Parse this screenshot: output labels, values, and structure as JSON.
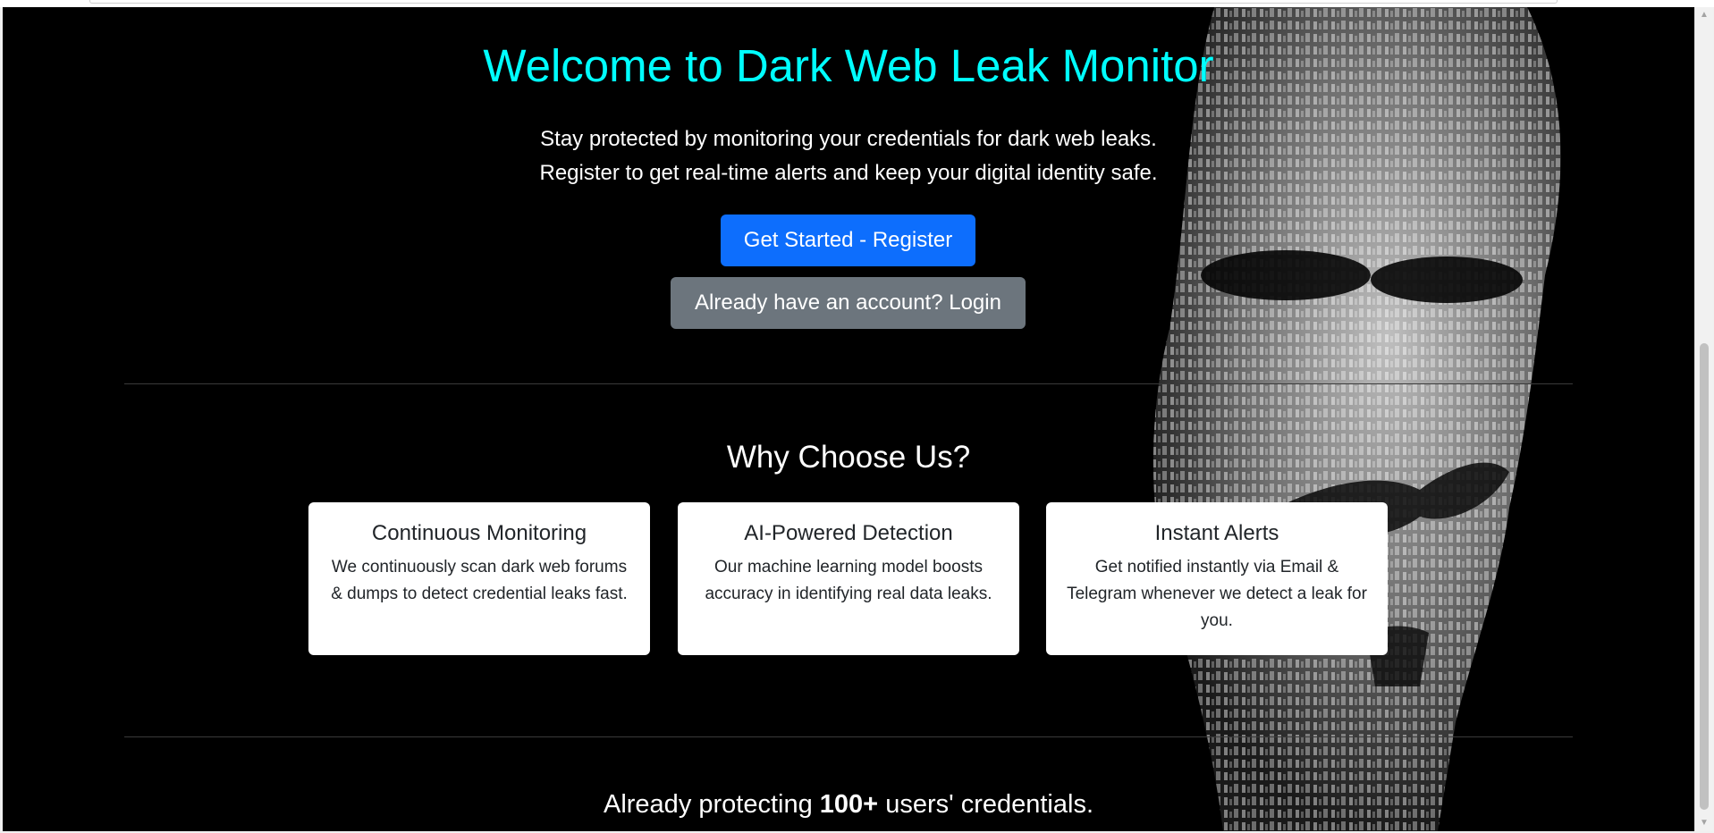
{
  "hero": {
    "title": "Welcome to Dark Web Leak Monitor",
    "line1": "Stay protected by monitoring your credentials for dark web leaks.",
    "line2": "Register to get real-time alerts and keep your digital identity safe.",
    "register_button": "Get Started - Register",
    "login_button": "Already have an account? Login"
  },
  "features": {
    "heading": "Why Choose Us?",
    "cards": [
      {
        "title": "Continuous Monitoring",
        "text": "We continuously scan dark web forums & dumps to detect credential leaks fast."
      },
      {
        "title": "AI-Powered Detection",
        "text": "Our machine learning model boosts accuracy in identifying real data leaks."
      },
      {
        "title": "Instant Alerts",
        "text": "Get notified instantly via Email & Telegram whenever we detect a leak for you."
      }
    ]
  },
  "stats": {
    "prefix": "Already protecting",
    "count": "100+",
    "suffix": "users' credentials."
  },
  "colors": {
    "background": "#000000",
    "title": "#00ffff",
    "primary_button": "#0d6efd",
    "secondary_button": "#6c757d",
    "card": "#ffffff"
  },
  "icons": {
    "background_image": "text-collage-mask-image",
    "scroll_up": "scroll-up-arrow-icon",
    "scroll_down": "scroll-down-arrow-icon"
  }
}
